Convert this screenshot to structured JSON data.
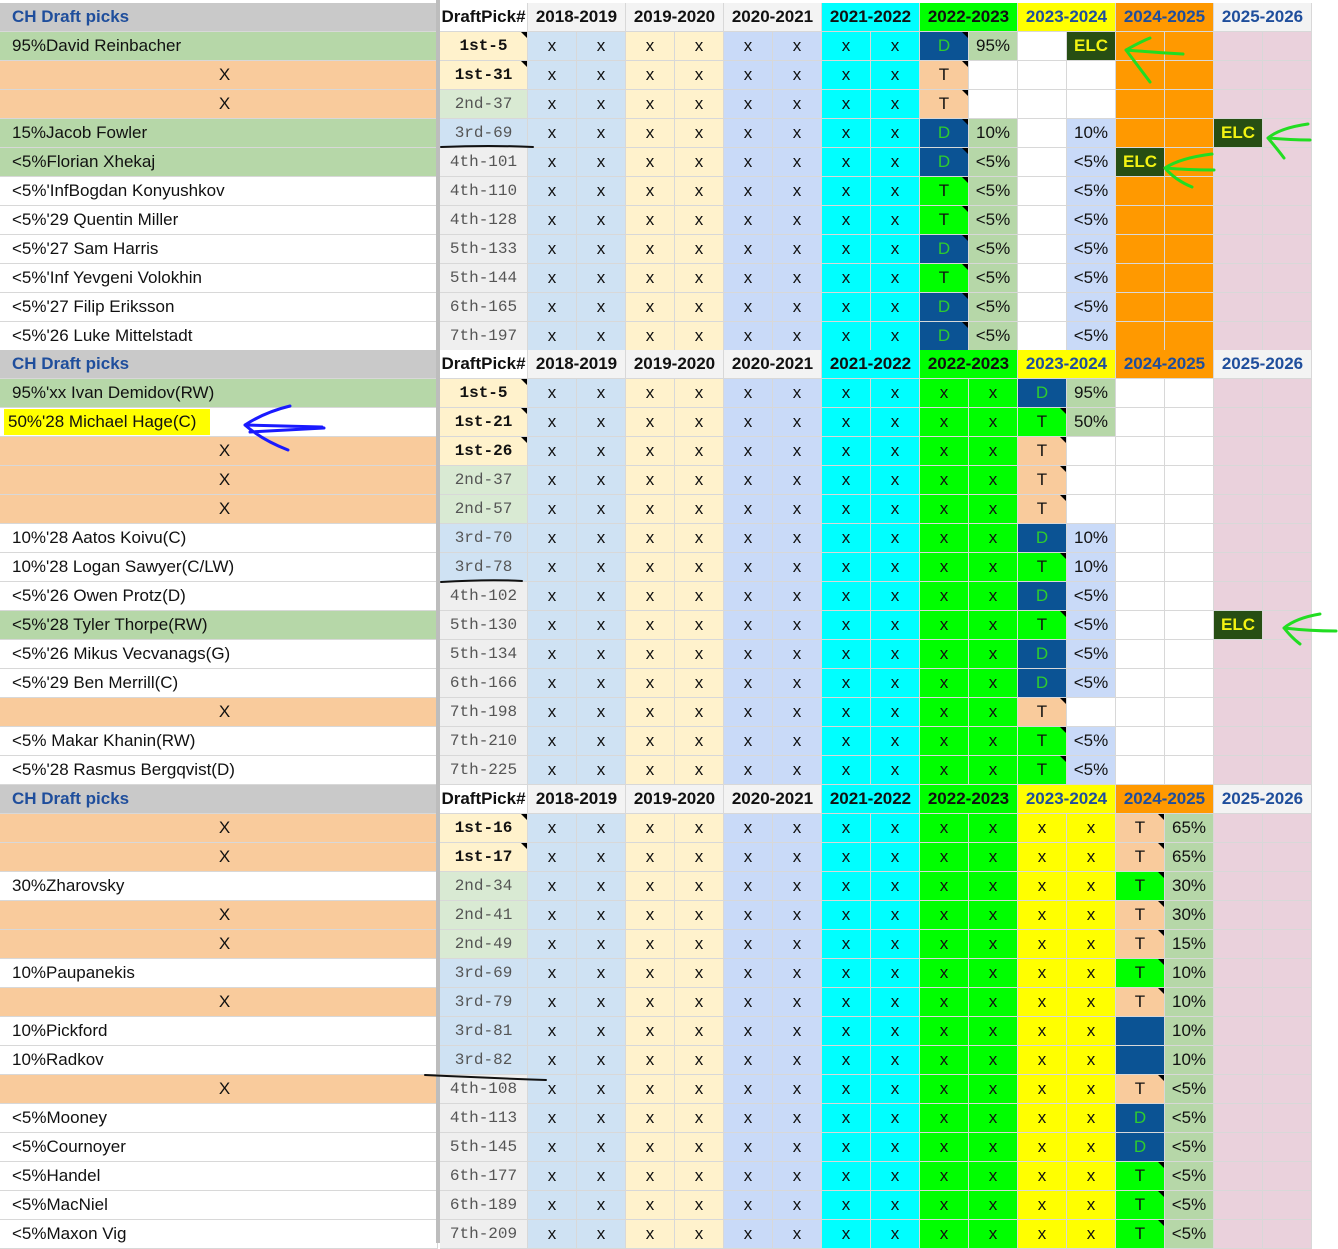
{
  "sheet": {
    "header": {
      "title": "CH Draft picks",
      "pick_col": "DraftPick#",
      "seasons": [
        "2018-2019",
        "2019-2020",
        "2020-2021",
        "2021-2022",
        "2022-2023",
        "2023-2024",
        "2024-2025",
        "2025-2026"
      ]
    },
    "colors": {
      "header_gray": "#c9c9c9",
      "title_blue": "#1f4e9c",
      "prospect_green": "#b6d7a8",
      "traded_orange": "#f9cb9c",
      "light_blue": "#cfe2f3",
      "light_yellow": "#fff2cc",
      "periwinkle": "#c9daf8",
      "cyan": "#00ffff",
      "bright_green": "#00ff00",
      "yellow": "#ffff00",
      "orange": "#ff9900",
      "pink": "#ead1dc",
      "dark_blue": "#0b5394",
      "dark_green": "#274e13",
      "sage": "#b6d7a8",
      "peach": "#f9cb9c"
    },
    "sections": [
      {
        "header": {
          "title": "CH Draft picks",
          "pick_col": "DraftPick#",
          "seasons": [
            "2018-2019",
            "2019-2020",
            "2020-2021",
            "2021-2022",
            "2022-2023",
            "2023-2024",
            "2024-2025",
            "2025-2026"
          ]
        },
        "rows": [
          {
            "name": "95%David Reinbacher",
            "pick": "1st-5",
            "cells": [
              "x",
              "x",
              "x",
              "x",
              "x",
              "x",
              "x",
              "x",
              "D",
              "95%",
              "",
              "ELC",
              "",
              "",
              "",
              ""
            ]
          },
          {
            "name": "X",
            "pick": "1st-31",
            "cells": [
              "x",
              "x",
              "x",
              "x",
              "x",
              "x",
              "x",
              "x",
              "T",
              "",
              "",
              "",
              "",
              "",
              "",
              ""
            ]
          },
          {
            "name": "X",
            "pick": "2nd-37",
            "cells": [
              "x",
              "x",
              "x",
              "x",
              "x",
              "x",
              "x",
              "x",
              "T",
              "",
              "",
              "",
              "",
              "",
              "",
              ""
            ]
          },
          {
            "name": "15%Jacob Fowler",
            "pick": "3rd-69",
            "cells": [
              "x",
              "x",
              "x",
              "x",
              "x",
              "x",
              "x",
              "x",
              "D",
              "10%",
              "",
              "10%",
              "",
              "",
              "ELC",
              ""
            ]
          },
          {
            "name": "<5%Florian Xhekaj",
            "pick": "4th-101",
            "cells": [
              "x",
              "x",
              "x",
              "x",
              "x",
              "x",
              "x",
              "x",
              "D",
              "<5%",
              "",
              "<5%",
              "ELC",
              "",
              "",
              ""
            ]
          },
          {
            "name": "<5%'InfBogdan Konyushkov",
            "pick": "4th-110",
            "cells": [
              "x",
              "x",
              "x",
              "x",
              "x",
              "x",
              "x",
              "x",
              "T",
              "<5%",
              "",
              "<5%",
              "",
              "",
              "",
              ""
            ]
          },
          {
            "name": "<5%'29 Quentin Miller",
            "pick": "4th-128",
            "cells": [
              "x",
              "x",
              "x",
              "x",
              "x",
              "x",
              "x",
              "x",
              "T",
              "<5%",
              "",
              "<5%",
              "",
              "",
              "",
              ""
            ]
          },
          {
            "name": "<5%'27 Sam Harris",
            "pick": "5th-133",
            "cells": [
              "x",
              "x",
              "x",
              "x",
              "x",
              "x",
              "x",
              "x",
              "D",
              "<5%",
              "",
              "<5%",
              "",
              "",
              "",
              ""
            ]
          },
          {
            "name": "<5%'Inf Yevgeni Volokhin",
            "pick": "5th-144",
            "cells": [
              "x",
              "x",
              "x",
              "x",
              "x",
              "x",
              "x",
              "x",
              "T",
              "<5%",
              "",
              "<5%",
              "",
              "",
              "",
              ""
            ]
          },
          {
            "name": "<5%'27 Filip Eriksson",
            "pick": "6th-165",
            "cells": [
              "x",
              "x",
              "x",
              "x",
              "x",
              "x",
              "x",
              "x",
              "D",
              "<5%",
              "",
              "<5%",
              "",
              "",
              "",
              ""
            ]
          },
          {
            "name": "<5%'26 Luke Mittelstadt",
            "pick": "7th-197",
            "cells": [
              "x",
              "x",
              "x",
              "x",
              "x",
              "x",
              "x",
              "x",
              "D",
              "<5%",
              "",
              "<5%",
              "",
              "",
              "",
              ""
            ]
          }
        ]
      },
      {
        "header": {
          "title": "CH Draft picks",
          "pick_col": "DraftPick#",
          "seasons": [
            "2018-2019",
            "2019-2020",
            "2020-2021",
            "2021-2022",
            "2022-2023",
            "2023-2024",
            "2024-2025",
            "2025-2026"
          ]
        },
        "rows": [
          {
            "name": "95%'xx Ivan Demidov(RW)",
            "pick": "1st-5",
            "cells": [
              "x",
              "x",
              "x",
              "x",
              "x",
              "x",
              "x",
              "x",
              "x",
              "x",
              "D",
              "95%",
              "",
              "",
              "",
              ""
            ]
          },
          {
            "name": "50%'28 Michael Hage(C)",
            "pick": "1st-21",
            "cells": [
              "x",
              "x",
              "x",
              "x",
              "x",
              "x",
              "x",
              "x",
              "x",
              "x",
              "T",
              "50%",
              "",
              "",
              "",
              ""
            ]
          },
          {
            "name": "X",
            "pick": "1st-26",
            "cells": [
              "x",
              "x",
              "x",
              "x",
              "x",
              "x",
              "x",
              "x",
              "x",
              "x",
              "T",
              "",
              "",
              "",
              "",
              ""
            ]
          },
          {
            "name": "X",
            "pick": "2nd-37",
            "cells": [
              "x",
              "x",
              "x",
              "x",
              "x",
              "x",
              "x",
              "x",
              "x",
              "x",
              "T",
              "",
              "",
              "",
              "",
              ""
            ]
          },
          {
            "name": "X",
            "pick": "2nd-57",
            "cells": [
              "x",
              "x",
              "x",
              "x",
              "x",
              "x",
              "x",
              "x",
              "x",
              "x",
              "T",
              "",
              "",
              "",
              "",
              ""
            ]
          },
          {
            "name": "10%'28 Aatos Koivu(C)",
            "pick": "3rd-70",
            "cells": [
              "x",
              "x",
              "x",
              "x",
              "x",
              "x",
              "x",
              "x",
              "x",
              "x",
              "D",
              "10%",
              "",
              "",
              "",
              ""
            ]
          },
          {
            "name": "10%'28 Logan Sawyer(C/LW)",
            "pick": "3rd-78",
            "cells": [
              "x",
              "x",
              "x",
              "x",
              "x",
              "x",
              "x",
              "x",
              "x",
              "x",
              "T",
              "10%",
              "",
              "",
              "",
              ""
            ]
          },
          {
            "name": "<5%'26 Owen Protz(D)",
            "pick": "4th-102",
            "cells": [
              "x",
              "x",
              "x",
              "x",
              "x",
              "x",
              "x",
              "x",
              "x",
              "x",
              "D",
              "<5%",
              "",
              "",
              "",
              ""
            ]
          },
          {
            "name": "<5%'28  Tyler Thorpe(RW)",
            "pick": "5th-130",
            "cells": [
              "x",
              "x",
              "x",
              "x",
              "x",
              "x",
              "x",
              "x",
              "x",
              "x",
              "T",
              "<5%",
              "",
              "",
              "ELC",
              ""
            ]
          },
          {
            "name": "<5%'26  Mikus Vecvanags(G)",
            "pick": "5th-134",
            "cells": [
              "x",
              "x",
              "x",
              "x",
              "x",
              "x",
              "x",
              "x",
              "x",
              "x",
              "D",
              "<5%",
              "",
              "",
              "",
              ""
            ]
          },
          {
            "name": "<5%'29 Ben Merrill(C)",
            "pick": "6th-166",
            "cells": [
              "x",
              "x",
              "x",
              "x",
              "x",
              "x",
              "x",
              "x",
              "x",
              "x",
              "D",
              "<5%",
              "",
              "",
              "",
              ""
            ]
          },
          {
            "name": "X",
            "pick": "7th-198",
            "cells": [
              "x",
              "x",
              "x",
              "x",
              "x",
              "x",
              "x",
              "x",
              "x",
              "x",
              "T",
              "",
              "",
              "",
              "",
              ""
            ]
          },
          {
            "name": "<5% Makar Khanin(RW)",
            "pick": "7th-210",
            "cells": [
              "x",
              "x",
              "x",
              "x",
              "x",
              "x",
              "x",
              "x",
              "x",
              "x",
              "T",
              "<5%",
              "",
              "",
              "",
              ""
            ]
          },
          {
            "name": "<5%'28 Rasmus Bergqvist(D)",
            "pick": "7th-225",
            "cells": [
              "x",
              "x",
              "x",
              "x",
              "x",
              "x",
              "x",
              "x",
              "x",
              "x",
              "T",
              "<5%",
              "",
              "",
              "",
              ""
            ]
          }
        ]
      },
      {
        "header": {
          "title": "CH Draft picks",
          "pick_col": "DraftPick#",
          "seasons": [
            "2018-2019",
            "2019-2020",
            "2020-2021",
            "2021-2022",
            "2022-2023",
            "2023-2024",
            "2024-2025",
            "2025-2026"
          ]
        },
        "rows": [
          {
            "name": "X",
            "pick": "1st-16",
            "cells": [
              "x",
              "x",
              "x",
              "x",
              "x",
              "x",
              "x",
              "x",
              "x",
              "x",
              "x",
              "x",
              "T",
              "65%",
              "",
              ""
            ]
          },
          {
            "name": "X",
            "pick": "1st-17",
            "cells": [
              "x",
              "x",
              "x",
              "x",
              "x",
              "x",
              "x",
              "x",
              "x",
              "x",
              "x",
              "x",
              "T",
              "65%",
              "",
              ""
            ]
          },
          {
            "name": "30%Zharovsky",
            "pick": "2nd-34",
            "cells": [
              "x",
              "x",
              "x",
              "x",
              "x",
              "x",
              "x",
              "x",
              "x",
              "x",
              "x",
              "x",
              "T",
              "30%",
              "",
              ""
            ]
          },
          {
            "name": "X",
            "pick": "2nd-41",
            "cells": [
              "x",
              "x",
              "x",
              "x",
              "x",
              "x",
              "x",
              "x",
              "x",
              "x",
              "x",
              "x",
              "T",
              "30%",
              "",
              ""
            ]
          },
          {
            "name": "X",
            "pick": "2nd-49",
            "cells": [
              "x",
              "x",
              "x",
              "x",
              "x",
              "x",
              "x",
              "x",
              "x",
              "x",
              "x",
              "x",
              "T",
              "15%",
              "",
              ""
            ]
          },
          {
            "name": "10%Paupanekis",
            "pick": "3rd-69",
            "cells": [
              "x",
              "x",
              "x",
              "x",
              "x",
              "x",
              "x",
              "x",
              "x",
              "x",
              "x",
              "x",
              "T",
              "10%",
              "",
              ""
            ]
          },
          {
            "name": "X",
            "pick": "3rd-79",
            "cells": [
              "x",
              "x",
              "x",
              "x",
              "x",
              "x",
              "x",
              "x",
              "x",
              "x",
              "x",
              "x",
              "T",
              "10%",
              "",
              ""
            ]
          },
          {
            "name": "10%Pickford",
            "pick": "3rd-81",
            "cells": [
              "x",
              "x",
              "x",
              "x",
              "x",
              "x",
              "x",
              "x",
              "x",
              "x",
              "x",
              "x",
              "",
              "10%",
              "",
              ""
            ]
          },
          {
            "name": "10%Radkov",
            "pick": "3rd-82",
            "cells": [
              "x",
              "x",
              "x",
              "x",
              "x",
              "x",
              "x",
              "x",
              "x",
              "x",
              "x",
              "x",
              "",
              "10%",
              "",
              ""
            ]
          },
          {
            "name": "X",
            "pick": "4th-108",
            "cells": [
              "x",
              "x",
              "x",
              "x",
              "x",
              "x",
              "x",
              "x",
              "x",
              "x",
              "x",
              "x",
              "T",
              "<5%",
              "",
              ""
            ]
          },
          {
            "name": "<5%Mooney",
            "pick": "4th-113",
            "cells": [
              "x",
              "x",
              "x",
              "x",
              "x",
              "x",
              "x",
              "x",
              "x",
              "x",
              "x",
              "x",
              "D",
              "<5%",
              "",
              ""
            ]
          },
          {
            "name": "<5%Cournoyer",
            "pick": "5th-145",
            "cells": [
              "x",
              "x",
              "x",
              "x",
              "x",
              "x",
              "x",
              "x",
              "x",
              "x",
              "x",
              "x",
              "D",
              "<5%",
              "",
              ""
            ]
          },
          {
            "name": "<5%Handel",
            "pick": "6th-177",
            "cells": [
              "x",
              "x",
              "x",
              "x",
              "x",
              "x",
              "x",
              "x",
              "x",
              "x",
              "x",
              "x",
              "T",
              "<5%",
              "",
              ""
            ]
          },
          {
            "name": "<5%MacNiel",
            "pick": "6th-189",
            "cells": [
              "x",
              "x",
              "x",
              "x",
              "x",
              "x",
              "x",
              "x",
              "x",
              "x",
              "x",
              "x",
              "T",
              "<5%",
              "",
              ""
            ]
          },
          {
            "name": "<5%Maxon Vig",
            "pick": "7th-209",
            "cells": [
              "x",
              "x",
              "x",
              "x",
              "x",
              "x",
              "x",
              "x",
              "x",
              "x",
              "x",
              "x",
              "T",
              "<5%",
              "",
              ""
            ]
          }
        ]
      }
    ]
  }
}
